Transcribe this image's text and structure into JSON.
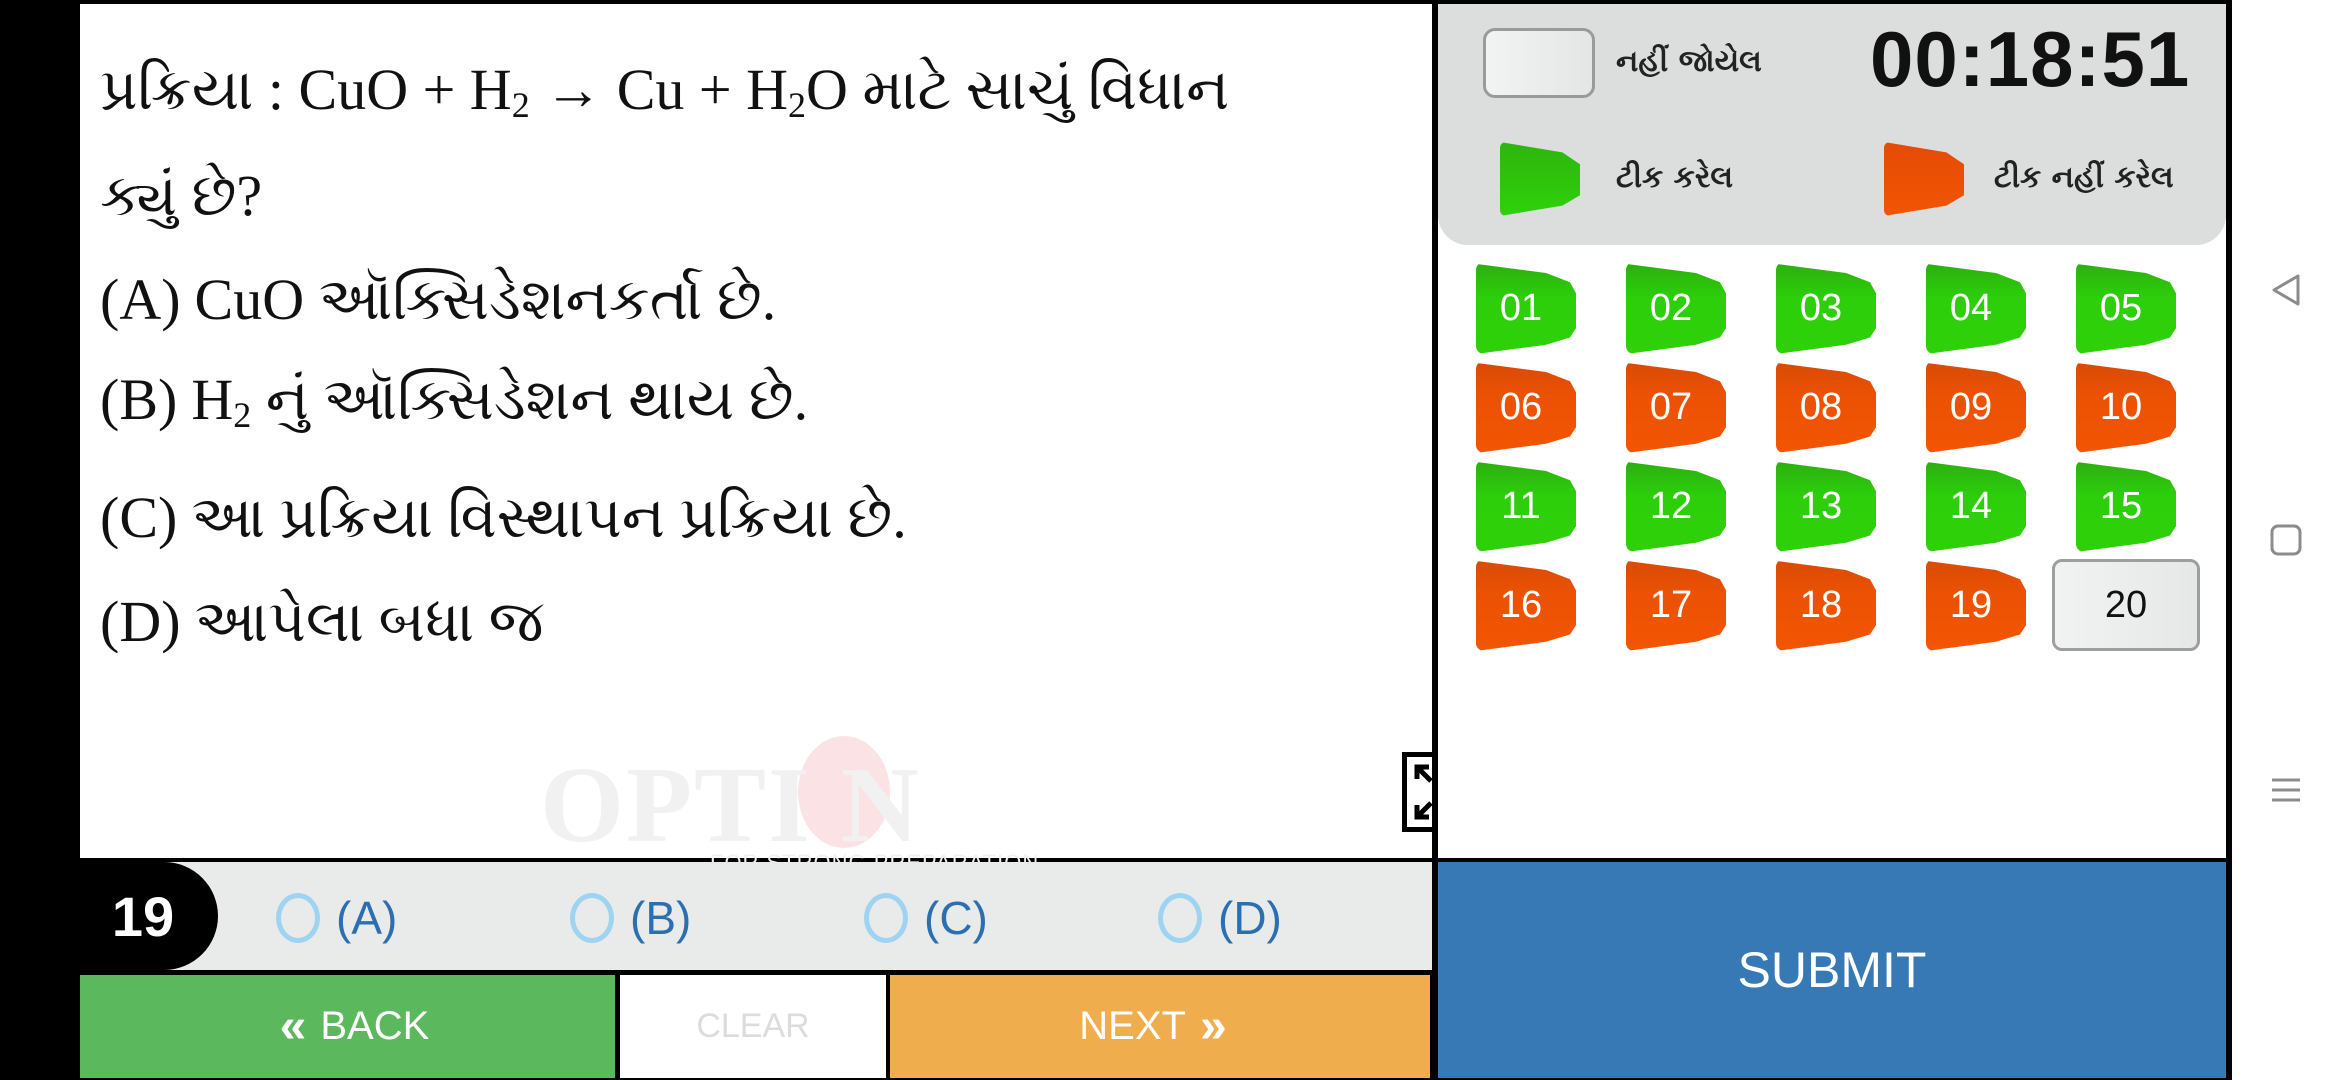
{
  "question": {
    "line1_prefix": "પ્રક્રિયા : CuO + H",
    "line1_sub1": "2",
    "line1_mid": " → Cu + H",
    "line1_sub2": "2",
    "line1_suffix": "O માટે સાચું વિધાન",
    "line2": "ક્યું છે?",
    "options": [
      {
        "label": "(A)",
        "text": "CuO ઑક્સિડેશનકર્તા છે."
      },
      {
        "label": "(B)",
        "text_prefix": "H",
        "sub": "2",
        "text": " નું ઑક્સિડેશન થાય છે."
      },
      {
        "label": "(C)",
        "text": "આ પ્રક્રિયા વિસ્થાપન પ્રક્રિયા છે."
      },
      {
        "label": "(D)",
        "text": "આપેલા બધા જ"
      }
    ]
  },
  "watermark": {
    "brand": "OPTI N",
    "tagline": "FOR STRONG PREPARATION"
  },
  "icons": {
    "next_question": "chevron-right-icon",
    "fullscreen": "expand-icon"
  },
  "legend": {
    "unseen_label": "નહીં જોયેલ",
    "ticked_label": "ટીક કરેલ",
    "unticked_label": "ટીક નહીં કરેલ"
  },
  "timer": "00:18:51",
  "question_grid": [
    {
      "num": "01",
      "status": "ticked"
    },
    {
      "num": "02",
      "status": "ticked"
    },
    {
      "num": "03",
      "status": "ticked"
    },
    {
      "num": "04",
      "status": "ticked"
    },
    {
      "num": "05",
      "status": "ticked"
    },
    {
      "num": "06",
      "status": "unticked"
    },
    {
      "num": "07",
      "status": "unticked"
    },
    {
      "num": "08",
      "status": "unticked"
    },
    {
      "num": "09",
      "status": "unticked"
    },
    {
      "num": "10",
      "status": "unticked"
    },
    {
      "num": "11",
      "status": "ticked"
    },
    {
      "num": "12",
      "status": "ticked"
    },
    {
      "num": "13",
      "status": "ticked"
    },
    {
      "num": "14",
      "status": "ticked"
    },
    {
      "num": "15",
      "status": "ticked"
    },
    {
      "num": "16",
      "status": "unticked"
    },
    {
      "num": "17",
      "status": "unticked"
    },
    {
      "num": "18",
      "status": "unticked"
    },
    {
      "num": "19",
      "status": "unticked"
    },
    {
      "num": "20",
      "status": "unseen"
    }
  ],
  "answer_bar": {
    "current_question": "19",
    "choices": [
      "(A)",
      "(B)",
      "(C)",
      "(D)"
    ]
  },
  "buttons": {
    "back": "BACK",
    "clear": "CLEAR",
    "next": "NEXT",
    "submit": "SUBMIT",
    "back_chevron": "«",
    "next_chevron": "»"
  },
  "colors": {
    "ticked": "#2ccf0a",
    "unticked": "#f25503",
    "back": "#5cb85c",
    "next": "#efad4e",
    "submit": "#3679b5",
    "answer_text": "#2c6fb0"
  },
  "system_nav": [
    "back",
    "home",
    "recents"
  ]
}
